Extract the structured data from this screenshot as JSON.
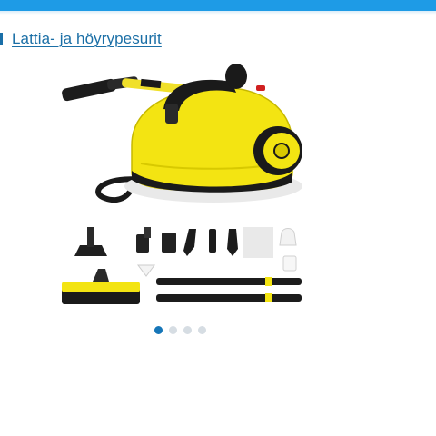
{
  "header": {
    "bar_color": "#1e9be6"
  },
  "breadcrumb": {
    "icon": "breadcrumb-marker-icon",
    "label": "Lattia- ja höyrypesurit",
    "link_color": "#1b6fa6"
  },
  "product_image": {
    "subject": "yellow steam cleaner with accessories",
    "accent_color": "#f3e412"
  },
  "carousel": {
    "total": 4,
    "active_index": 0,
    "active_color": "#1676b8",
    "inactive_color": "#d6dde3"
  }
}
